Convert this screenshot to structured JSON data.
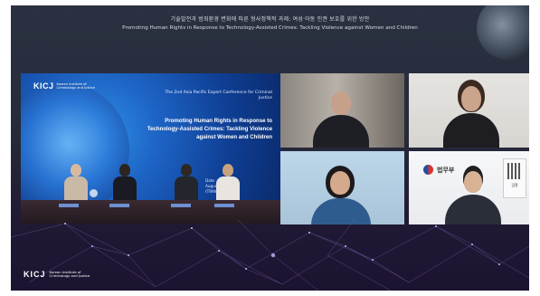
{
  "header": {
    "title_ko": "기술발전과 범죄환경 변화에 따른 형사정책적 과제: 여성·아동 인권 보호를 위한 방안",
    "title_en": "Promoting Human Rights in Response to Technology-Assisted Crimes: Tackling Violence against Women and Children"
  },
  "stage": {
    "logo_mark": "KICJ",
    "logo_name": "Korean Institute of Criminology and Justice",
    "conference": "The 2nd Asia Pacific Expert Conference for Criminal Justice",
    "title": "Promoting Human Rights in Response to Technology-Assisted Crimes: Tackling Violence against Women and Children",
    "date_line1": "Date",
    "date_line2": "August 2022",
    "date_line3": "(TRANSMEDIA)"
  },
  "tiles": [
    {
      "label": ""
    },
    {
      "label": ""
    },
    {
      "label": ""
    },
    {
      "label": "",
      "org": "법무부",
      "sign": "검찰"
    }
  ],
  "footer": {
    "logo_mark": "KICJ",
    "logo_name": "Korean Institute of Criminology and Justice"
  }
}
